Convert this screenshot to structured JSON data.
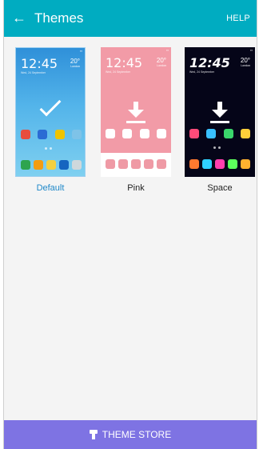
{
  "app_bar": {
    "back_icon": "arrow-left-icon",
    "title": "Themes",
    "help": "HELP",
    "color": "#00acc1"
  },
  "themes": [
    {
      "name": "Default",
      "selected": true,
      "preview": {
        "time": "12:45",
        "date": "Wed, 24 September",
        "temp": "20°",
        "location": "London",
        "overlay_icon": "check-icon",
        "colors": [
          "#2f90d9",
          "#7fd0f0"
        ]
      }
    },
    {
      "name": "Pink",
      "selected": false,
      "preview": {
        "time": "12:45",
        "date": "Wed, 24 September",
        "temp": "20°",
        "location": "London",
        "overlay_icon": "download-icon",
        "colors": [
          "#f29ba7",
          "#ffffff"
        ]
      }
    },
    {
      "name": "Space",
      "selected": false,
      "preview": {
        "time": "12:45",
        "date": "Wed, 24 September",
        "temp": "20°",
        "location": "London",
        "overlay_icon": "download-icon",
        "colors": [
          "#050518"
        ]
      }
    }
  ],
  "theme_store": {
    "icon": "paint-brush-icon",
    "label": "THEME STORE",
    "color": "#7e73e3"
  },
  "accent_selected": "#1e88c9"
}
